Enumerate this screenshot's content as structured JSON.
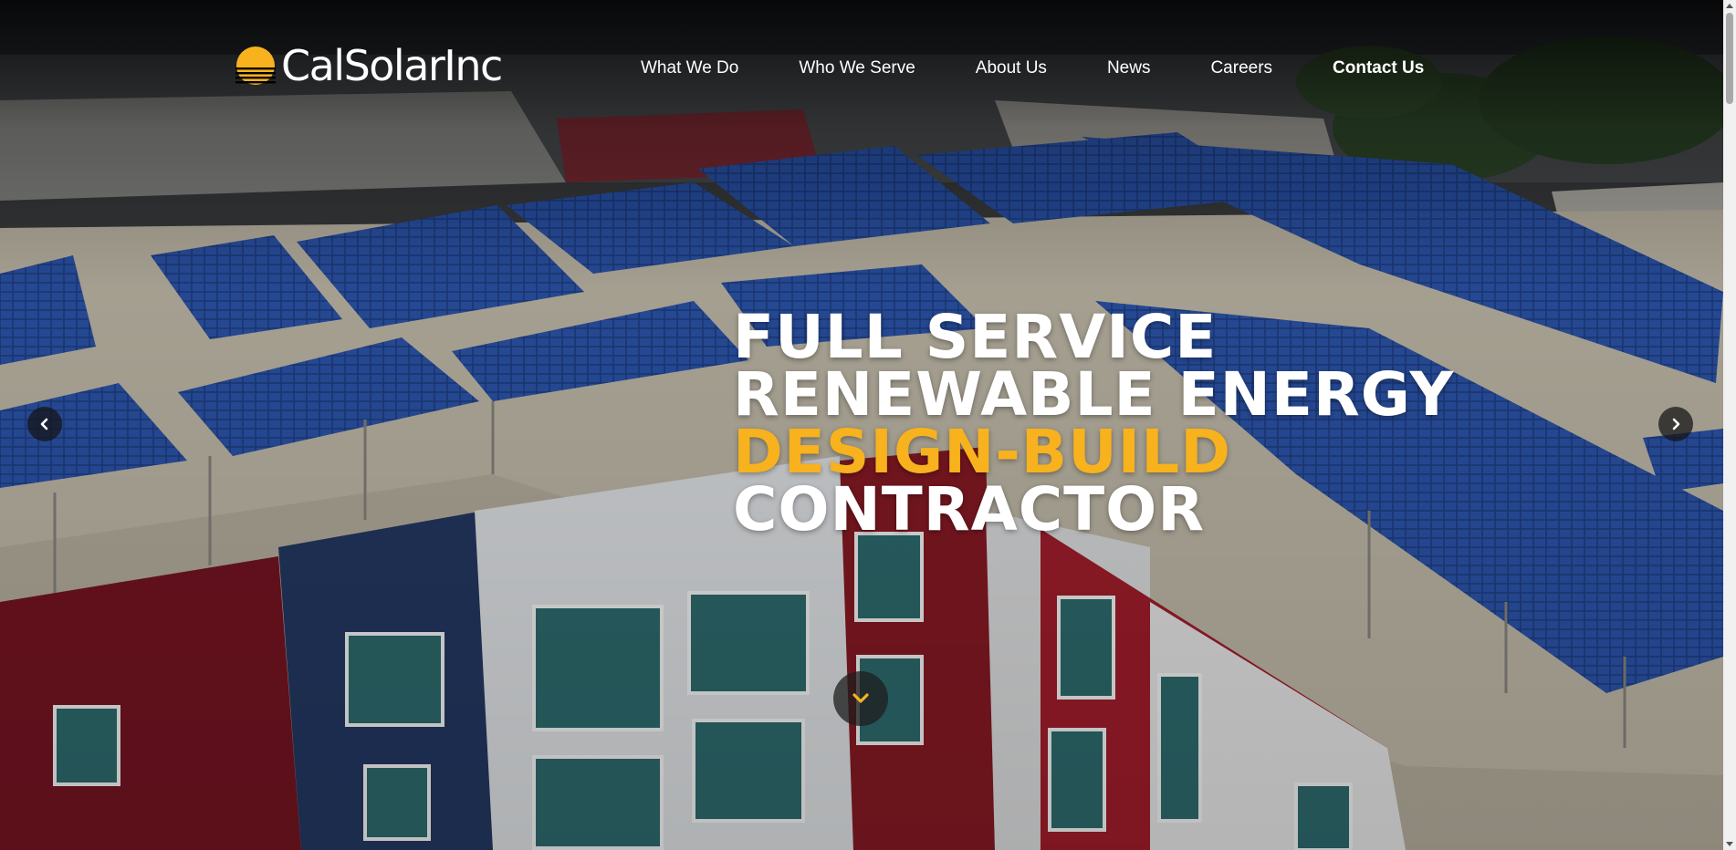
{
  "brand": {
    "name": "CalSolarInc",
    "logo_icon": "sun-sunset-icon",
    "logo_color": "#f7b21d"
  },
  "nav": {
    "items": [
      {
        "label": "What We Do"
      },
      {
        "label": "Who We Serve"
      },
      {
        "label": "About Us"
      },
      {
        "label": "News"
      },
      {
        "label": "Careers"
      },
      {
        "label": "Contact Us"
      }
    ]
  },
  "hero": {
    "line1": "FULL SERVICE",
    "line2": "RENEWABLE ENERGY",
    "line3": "DESIGN-BUILD",
    "line4": "CONTRACTOR",
    "accent_color": "#f7b21d",
    "text_color": "#ffffff"
  },
  "controls": {
    "prev_icon": "chevron-left-icon",
    "next_icon": "chevron-right-icon",
    "scroll_icon": "chevron-down-icon"
  }
}
